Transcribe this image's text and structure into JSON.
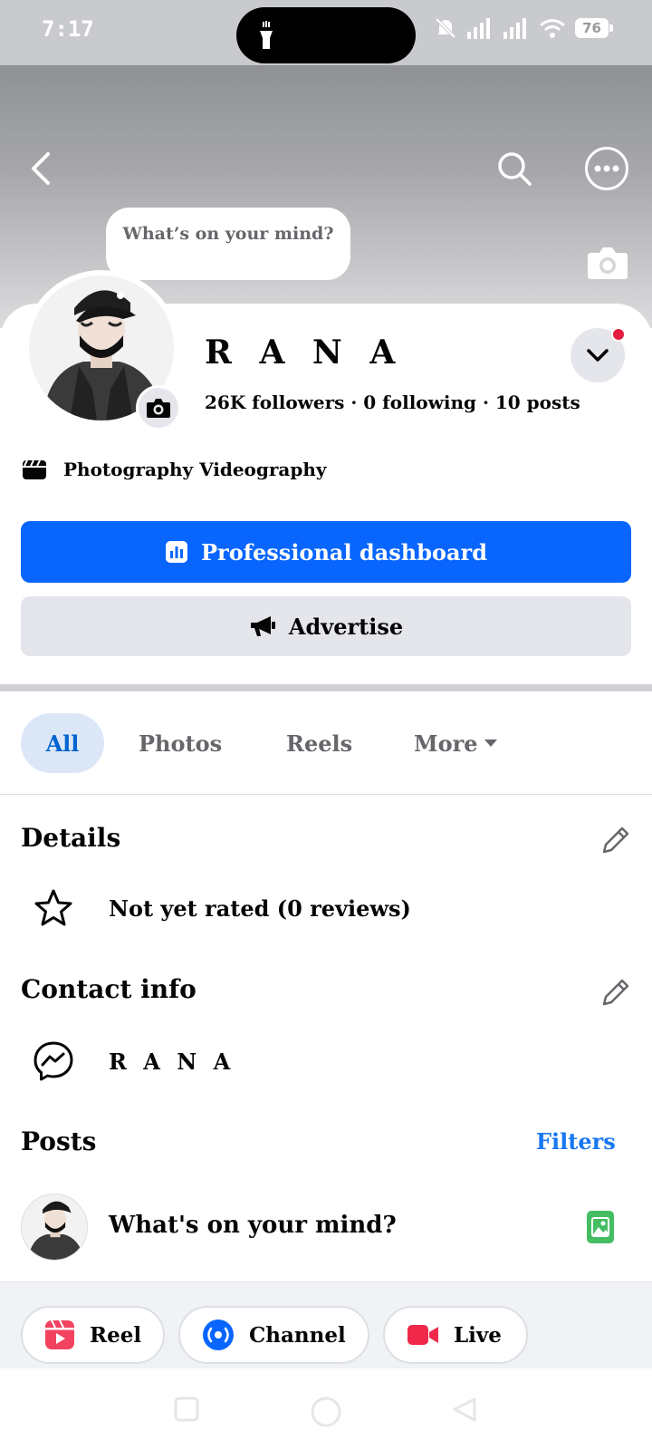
{
  "status_bar": {
    "time": "7:17",
    "battery": "76"
  },
  "cover": {
    "bubble_text": "What’s on your mind?"
  },
  "profile": {
    "name": "R A N A",
    "stats": "26K followers · 0 following · 10 posts",
    "category": "Photography Videography"
  },
  "buttons": {
    "primary": "Professional dashboard",
    "secondary": "Advertise"
  },
  "tabs": [
    {
      "label": "All"
    },
    {
      "label": "Photos"
    },
    {
      "label": "Reels"
    },
    {
      "label": "More"
    }
  ],
  "details": {
    "title": "Details",
    "rating": "Not yet rated (0 reviews)"
  },
  "contact": {
    "title": "Contact info",
    "messenger": "R A N A"
  },
  "posts": {
    "title": "Posts",
    "filters": "Filters",
    "composer_placeholder": "What's on your mind?"
  },
  "actions": [
    {
      "label": "Reel",
      "icon": "reel-icon",
      "color": "#f3425f"
    },
    {
      "label": "Channel",
      "icon": "channel-icon",
      "color": "#0866ff"
    },
    {
      "label": "Live",
      "icon": "live-video-icon",
      "color": "#f02849"
    }
  ],
  "colors": {
    "accent": "#0866ff",
    "link": "#1877f2",
    "notification": "#e41e3f"
  }
}
